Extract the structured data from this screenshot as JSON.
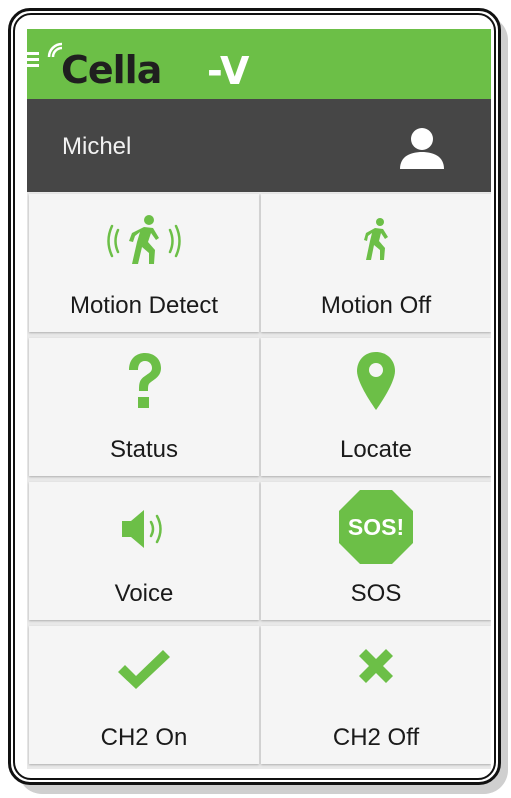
{
  "app": {
    "name": "Cella",
    "name_suffix": "-V"
  },
  "header": {
    "username": "Michel"
  },
  "tiles": [
    {
      "label": "Motion Detect",
      "icon": "motion-detect-icon"
    },
    {
      "label": "Motion Off",
      "icon": "running-person-icon"
    },
    {
      "label": "Status",
      "icon": "question-mark-icon"
    },
    {
      "label": "Locate",
      "icon": "map-pin-icon"
    },
    {
      "label": "Voice",
      "icon": "speaker-icon"
    },
    {
      "label": "SOS",
      "icon": "sos-stop-sign-icon",
      "sign_text": "SOS!"
    },
    {
      "label": "CH2 On",
      "icon": "checkmark-icon"
    },
    {
      "label": "CH2 Off",
      "icon": "x-icon"
    }
  ],
  "colors": {
    "accent": "#6cbf47",
    "header_dark": "#464646",
    "tile_bg": "#f5f5f5"
  }
}
